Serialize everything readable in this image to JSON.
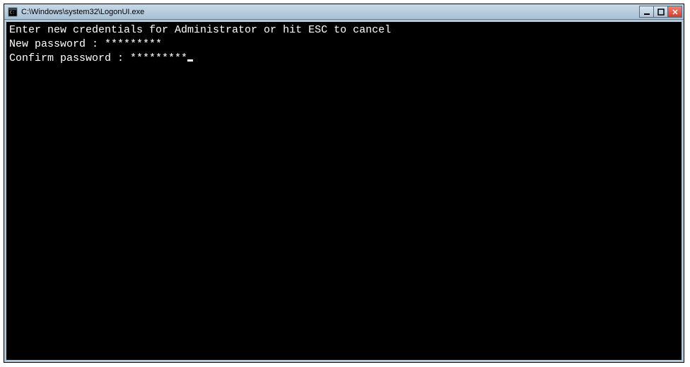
{
  "window": {
    "title": "C:\\Windows\\system32\\LogonUI.exe"
  },
  "console": {
    "line1": "Enter new credentials for Administrator or hit ESC to cancel",
    "line2_label": "New password : ",
    "line2_value": "*********",
    "line3_label": "Confirm password : ",
    "line3_value": "*********"
  }
}
